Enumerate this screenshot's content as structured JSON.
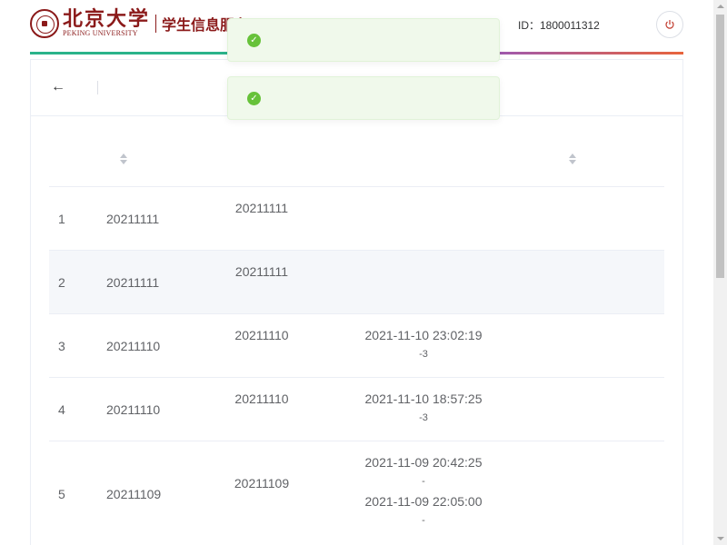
{
  "header": {
    "logo_cn": "北京大学",
    "logo_en": "PEKING UNIVERSITY",
    "system_title": "学生信息服务",
    "user_prefix": "",
    "user_id_text": "ID：1800011312",
    "user_suffix": "",
    "logout_icon": "power-icon"
  },
  "notifications": [
    {
      "icon": "check-circle-icon",
      "text": ""
    },
    {
      "icon": "check-circle-icon",
      "text": ""
    }
  ],
  "page": {
    "back_label": "",
    "title": ""
  },
  "table": {
    "columns": [
      "",
      "",
      "",
      ""
    ],
    "rows": [
      {
        "index": "1",
        "date": "20211111",
        "status": "20211111 ",
        "tag": "",
        "times": [],
        "op": ""
      },
      {
        "index": "2",
        "date": "20211111",
        "status": "20211111 ",
        "tag": "",
        "times": [],
        "op": ""
      },
      {
        "index": "3",
        "date": "20211110",
        "status": "20211110 ",
        "tag": "",
        "times": [
          {
            "time": "2021-11-10 23:02:19 ",
            "sub": "-3 "
          }
        ],
        "op": ""
      },
      {
        "index": "4",
        "date": "20211110",
        "status": "20211110 ",
        "tag": "",
        "times": [
          {
            "time": "2021-11-10 18:57:25 ",
            "sub": "-3 "
          }
        ],
        "op": ""
      },
      {
        "index": "5",
        "date": "20211109",
        "status": "20211109 ",
        "tag": "",
        "times": [
          {
            "time": "2021-11-09 20:42:25 ",
            "sub": "- "
          },
          {
            "time": "2021-11-09 22:05:00 ",
            "sub": "- "
          }
        ],
        "op": ""
      }
    ]
  },
  "colors": {
    "brand": "#8b1a1a",
    "success": "#67c23a",
    "success_bg": "#f0f9eb"
  }
}
